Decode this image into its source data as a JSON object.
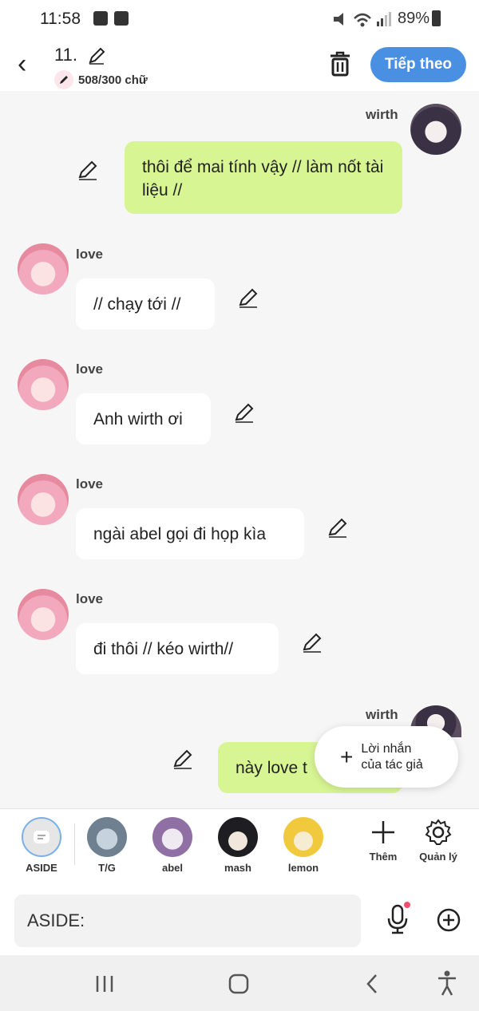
{
  "status_bar": {
    "time": "11:58",
    "battery": "89%"
  },
  "header": {
    "title": "11.",
    "char_count": "508/300 chữ",
    "next_label": "Tiếp theo"
  },
  "messages": [
    {
      "sender": "wirth",
      "text": "thôi để mai tính vậy // làm nốt tài liệu //",
      "side": "right"
    },
    {
      "sender": "love",
      "text": "// chạy tới //",
      "side": "left"
    },
    {
      "sender": "love",
      "text": "Anh wirth ơi",
      "side": "left"
    },
    {
      "sender": "love",
      "text": "ngài abel gọi đi họp kìa",
      "side": "left"
    },
    {
      "sender": "love",
      "text": "đi thôi // kéo wirth//",
      "side": "left"
    },
    {
      "sender": "wirth",
      "text": "này love t",
      "side": "right"
    }
  ],
  "popup": {
    "line1": "Lời nhắn",
    "line2": "của tác giả"
  },
  "characters": [
    "ASIDE",
    "T/G",
    "abel",
    "mash",
    "lemon"
  ],
  "char_actions": {
    "add": "Thêm",
    "manage": "Quản lý"
  },
  "input": {
    "value": "ASIDE:"
  },
  "colors": {
    "accent": "#4a90e2",
    "bubble_green": "#d8f594"
  }
}
